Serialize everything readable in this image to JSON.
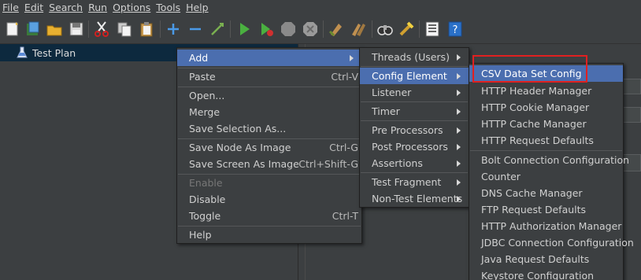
{
  "menubar": [
    "File",
    "Edit",
    "Search",
    "Run",
    "Options",
    "Tools",
    "Help"
  ],
  "toolbar": {
    "icons": [
      "new-icon",
      "templates-icon",
      "open-icon",
      "save-icon",
      "cut-icon",
      "copy-icon",
      "paste-icon",
      "expand-icon",
      "collapse-icon",
      "toggle-icon",
      "start-icon",
      "start-no-pause-icon",
      "stop-icon",
      "shutdown-icon",
      "clear-icon",
      "clear-all-icon",
      "search-icon",
      "reset-search-icon",
      "function-helper-icon",
      "help-icon"
    ]
  },
  "tree": {
    "root": "Test Plan"
  },
  "context_menu": {
    "items": [
      {
        "label": "Add",
        "accel": "",
        "submenu": true,
        "selected": true,
        "enabled": true
      },
      {
        "label": "Paste",
        "accel": "Ctrl-V",
        "enabled": true
      },
      {
        "label": "Open...",
        "accel": "",
        "enabled": true
      },
      {
        "label": "Merge",
        "accel": "",
        "enabled": true
      },
      {
        "label": "Save Selection As...",
        "accel": "",
        "enabled": true
      },
      {
        "label": "Save Node As Image",
        "accel": "Ctrl-G",
        "enabled": true
      },
      {
        "label": "Save Screen As Image",
        "accel": "Ctrl+Shift-G",
        "enabled": true
      },
      {
        "label": "Enable",
        "accel": "",
        "enabled": false
      },
      {
        "label": "Disable",
        "accel": "",
        "enabled": true
      },
      {
        "label": "Toggle",
        "accel": "Ctrl-T",
        "enabled": true
      },
      {
        "label": "Help",
        "accel": "",
        "enabled": true
      }
    ]
  },
  "add_menu": {
    "items": [
      "Threads (Users)",
      "Config Element",
      "Listener",
      "Timer",
      "Pre Processors",
      "Post Processors",
      "Assertions",
      "Test Fragment",
      "Non-Test Elements"
    ],
    "selected": "Config Element"
  },
  "config_menu": {
    "items": [
      "CSV Data Set Config",
      "HTTP Header Manager",
      "HTTP Cookie Manager",
      "HTTP Cache Manager",
      "HTTP Request Defaults",
      "Bolt Connection Configuration",
      "Counter",
      "DNS Cache Manager",
      "FTP Request Defaults",
      "HTTP Authorization Manager",
      "JDBC Connection Configuration",
      "Java Request Defaults",
      "Keystore Configuration"
    ],
    "selected": "CSV Data Set Config"
  },
  "colors": {
    "background": "#3c3f41",
    "selection": "#4b6eaf",
    "highlight_box": "#e02020",
    "tree_selection": "#0d293e"
  }
}
